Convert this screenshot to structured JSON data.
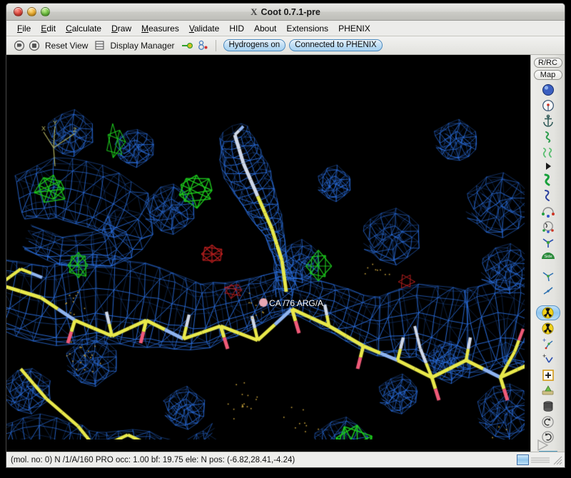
{
  "window": {
    "title": "Coot 0.7.1-pre",
    "logo_glyph": "X",
    "controls": [
      {
        "name": "close",
        "color": "#e4483c"
      },
      {
        "name": "minimize",
        "color": "#f0b02e"
      },
      {
        "name": "zoom",
        "color": "#71c541"
      }
    ]
  },
  "menubar": {
    "items": [
      {
        "label": "File",
        "mnemonic": "F"
      },
      {
        "label": "Edit",
        "mnemonic": "E"
      },
      {
        "label": "Calculate",
        "mnemonic": "C"
      },
      {
        "label": "Draw",
        "mnemonic": "D"
      },
      {
        "label": "Measures",
        "mnemonic": "M"
      },
      {
        "label": "Validate",
        "mnemonic": "V"
      },
      {
        "label": "HID",
        "mnemonic": ""
      },
      {
        "label": "About",
        "mnemonic": ""
      },
      {
        "label": "Extensions",
        "mnemonic": ""
      },
      {
        "label": "PHENIX",
        "mnemonic": ""
      }
    ]
  },
  "toolbar": {
    "reset_view_label": "Reset View",
    "display_manager_label": "Display Manager",
    "hydrogens_button": "Hydrogens on",
    "phenix_button": "Connected to PHENIX",
    "icons": [
      "go-to-ligand-icon",
      "go-to-blob-icon",
      "display-manager-icon",
      "green-arrow-icon",
      "atom-pick-icon"
    ]
  },
  "right_toolbar": {
    "buttons": [
      {
        "label": "R/RC",
        "name": "reset-rotation-centre-button"
      },
      {
        "label": "Map",
        "name": "map-button"
      }
    ],
    "icons": [
      "sphere-icon",
      "rotation-centre-icon",
      "anchor-icon",
      "ramachandran-icon",
      "rotamer-icon",
      "pointer-icon",
      "refine-zone-icon",
      "regularize-zone-icon",
      "fix-atoms-icon",
      "sphere-refine-icon",
      "rotate-translate-icon",
      "side-chain-icon",
      "edit-chi-icon",
      "torsion-general-icon",
      "radioactive-icon",
      "add-terminal-residue-icon",
      "add-atom-icon",
      "add-plus-icon",
      "mutate-icon",
      "delete-icon",
      "undo-icon",
      "redo-icon",
      "azerbaijan-flag-icon",
      "play-triangle-icon"
    ],
    "selected_icon": "radioactive-icon"
  },
  "statusbar": {
    "text": "(mol. no: 0)  N  /1/A/160 PRO occ:  1.00 bf: 19.75 ele:  N pos: (-6.82,28.41,-4.24)",
    "molecule_number": "0",
    "atom_name": "N",
    "residue_spec": "/1/A/160 PRO",
    "occupancy": "1.00",
    "b_factor": "19.75",
    "element": "N",
    "position": "(-6.82,28.41,-4.24)"
  },
  "canvas": {
    "atom_label": "CA /76 ARG/A",
    "axes": {
      "x": "X",
      "y": "Y",
      "z": "Z"
    },
    "background_color": "#000000",
    "colors": {
      "map_2fofc": "#2a6fe0",
      "map_difference_positive": "#1ecb1e",
      "map_difference_negative": "#c02020",
      "carbon": "#e8e84a",
      "nitrogen": "#8fb4f0",
      "oxygen": "#f05a78",
      "hydrogen": "#cfd8e8",
      "axes_color": "#b0b060"
    }
  }
}
